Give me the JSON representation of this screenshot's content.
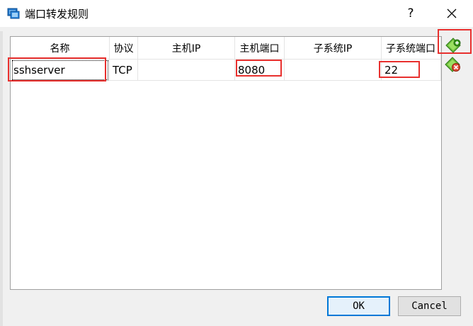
{
  "window": {
    "title": "端口转发规则"
  },
  "titlebar": {
    "help_label": "?"
  },
  "table": {
    "headers": [
      "名称",
      "协议",
      "主机IP",
      "主机端口",
      "子系统IP",
      "子系统端口"
    ],
    "rows": [
      {
        "name": "sshserver",
        "protocol": "TCP",
        "host_ip": "",
        "host_port": "8080",
        "guest_ip": "",
        "guest_port": "22"
      }
    ]
  },
  "side_buttons": {
    "add_icon": "add-rule-icon",
    "remove_icon": "remove-rule-icon"
  },
  "buttons": {
    "ok": "OK",
    "cancel": "Cancel"
  },
  "colors": {
    "highlight": "#e8302e",
    "default_button_border": "#0078d7"
  }
}
